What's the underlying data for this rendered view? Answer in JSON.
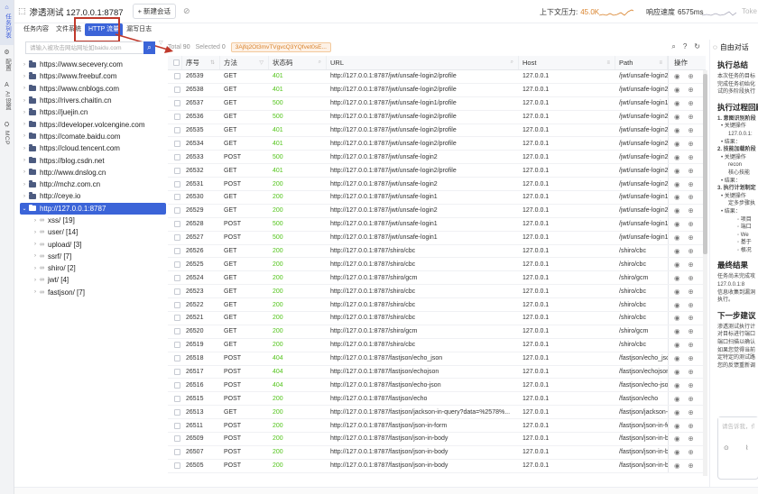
{
  "left_nav": [
    {
      "icon": "⌂",
      "label": "任务列表",
      "active": true
    },
    {
      "icon": "⚙",
      "label": "配置",
      "active": false
    },
    {
      "icon": "A",
      "label": "AI设置",
      "active": false
    },
    {
      "icon": "⛭",
      "label": "MCP",
      "active": false
    }
  ],
  "header": {
    "title": "渗透测试 127.0.0.1:8787",
    "new_button": "+ 新建会话",
    "context_pressure_label": "上下文压力:",
    "context_pressure_value": "45.0K",
    "response_speed_label": "响应速度",
    "response_speed_value": "6575ms",
    "tokens_label": "Toke"
  },
  "tabs": [
    "任务内容",
    "文件系统",
    "HTTP 流量",
    "漏写日志"
  ],
  "active_tab": 2,
  "site_search": {
    "placeholder": "请输入被攻击网站网址如baidu.com"
  },
  "toolbar": {
    "total_label": "Total",
    "total_value": "90",
    "selected_label": "Selected",
    "selected_value": "0",
    "token_tag": "3Ajfq2Ot3mvTVgvcQ3YQfvet0sE..."
  },
  "sites": [
    "https://www.secevery.com",
    "https://www.freebuf.com",
    "https://www.cnblogs.com",
    "https://rivers.chaitin.cn",
    "https://juejin.cn",
    "https://developer.volcengine.com",
    "https://comate.baidu.com",
    "https://cloud.tencent.com",
    "https://blog.csdn.net",
    "http://www.dnslog.cn",
    "http://mchz.com.cn",
    "http://ceye.io"
  ],
  "selected_site": "http://127.0.0.1:8787",
  "site_children": [
    "xss/ [19]",
    "user/ [14]",
    "upload/ [3]",
    "ssrf/ [7]",
    "shiro/ [2]",
    "jwt/ [4]",
    "fastjson/ [7]"
  ],
  "table": {
    "headers": [
      "序号",
      "方法",
      "状态码",
      "URL",
      "Host",
      "Path",
      "操作"
    ],
    "rows": [
      [
        "26539",
        "GET",
        "401",
        "http://127.0.0.1:8787/jwt/unsafe-login2/profile",
        "127.0.0.1",
        "/jwt/unsafe-login2/profile"
      ],
      [
        "26538",
        "GET",
        "401",
        "http://127.0.0.1:8787/jwt/unsafe-login2/profile",
        "127.0.0.1",
        "/jwt/unsafe-login2/profile"
      ],
      [
        "26537",
        "GET",
        "500",
        "http://127.0.0.1:8787/jwt/unsafe-login1/profile",
        "127.0.0.1",
        "/jwt/unsafe-login1/profile"
      ],
      [
        "26536",
        "GET",
        "500",
        "http://127.0.0.1:8787/jwt/unsafe-login2/profile",
        "127.0.0.1",
        "/jwt/unsafe-login2/profile"
      ],
      [
        "26535",
        "GET",
        "401",
        "http://127.0.0.1:8787/jwt/unsafe-login2/profile",
        "127.0.0.1",
        "/jwt/unsafe-login2/profile"
      ],
      [
        "26534",
        "GET",
        "401",
        "http://127.0.0.1:8787/jwt/unsafe-login2/profile",
        "127.0.0.1",
        "/jwt/unsafe-login2/profile"
      ],
      [
        "26533",
        "POST",
        "500",
        "http://127.0.0.1:8787/jwt/unsafe-login2",
        "127.0.0.1",
        "/jwt/unsafe-login2"
      ],
      [
        "26532",
        "GET",
        "401",
        "http://127.0.0.1:8787/jwt/unsafe-login2/profile",
        "127.0.0.1",
        "/jwt/unsafe-login2/profile"
      ],
      [
        "26531",
        "POST",
        "200",
        "http://127.0.0.1:8787/jwt/unsafe-login2",
        "127.0.0.1",
        "/jwt/unsafe-login2"
      ],
      [
        "26530",
        "GET",
        "200",
        "http://127.0.0.1:8787/jwt/unsafe-login1",
        "127.0.0.1",
        "/jwt/unsafe-login1"
      ],
      [
        "26529",
        "GET",
        "200",
        "http://127.0.0.1:8787/jwt/unsafe-login2",
        "127.0.0.1",
        "/jwt/unsafe-login2"
      ],
      [
        "26528",
        "POST",
        "500",
        "http://127.0.0.1:8787/jwt/unsafe-login1",
        "127.0.0.1",
        "/jwt/unsafe-login1"
      ],
      [
        "26527",
        "POST",
        "500",
        "http://127.0.0.1:8787/jwt/unsafe-login1",
        "127.0.0.1",
        "/jwt/unsafe-login1"
      ],
      [
        "26526",
        "GET",
        "200",
        "http://127.0.0.1:8787/shiro/cbc",
        "127.0.0.1",
        "/shiro/cbc"
      ],
      [
        "26525",
        "GET",
        "200",
        "http://127.0.0.1:8787/shiro/cbc",
        "127.0.0.1",
        "/shiro/cbc"
      ],
      [
        "26524",
        "GET",
        "200",
        "http://127.0.0.1:8787/shiro/gcm",
        "127.0.0.1",
        "/shiro/gcm"
      ],
      [
        "26523",
        "GET",
        "200",
        "http://127.0.0.1:8787/shiro/cbc",
        "127.0.0.1",
        "/shiro/cbc"
      ],
      [
        "26522",
        "GET",
        "200",
        "http://127.0.0.1:8787/shiro/cbc",
        "127.0.0.1",
        "/shiro/cbc"
      ],
      [
        "26521",
        "GET",
        "200",
        "http://127.0.0.1:8787/shiro/cbc",
        "127.0.0.1",
        "/shiro/cbc"
      ],
      [
        "26520",
        "GET",
        "200",
        "http://127.0.0.1:8787/shiro/gcm",
        "127.0.0.1",
        "/shiro/gcm"
      ],
      [
        "26519",
        "GET",
        "200",
        "http://127.0.0.1:8787/shiro/cbc",
        "127.0.0.1",
        "/shiro/cbc"
      ],
      [
        "26518",
        "POST",
        "404",
        "http://127.0.0.1:8787/fastjson/echo_json",
        "127.0.0.1",
        "/fastjson/echo_json"
      ],
      [
        "26517",
        "POST",
        "404",
        "http://127.0.0.1:8787/fastjson/echojson",
        "127.0.0.1",
        "/fastjson/echojson"
      ],
      [
        "26516",
        "POST",
        "404",
        "http://127.0.0.1:8787/fastjson/echo-json",
        "127.0.0.1",
        "/fastjson/echo-json"
      ],
      [
        "26515",
        "POST",
        "200",
        "http://127.0.0.1:8787/fastjson/echo",
        "127.0.0.1",
        "/fastjson/echo"
      ],
      [
        "26513",
        "GET",
        "200",
        "http://127.0.0.1:8787/fastjson/jackson-in-query?data=%2578%...",
        "127.0.0.1",
        "/fastjson/jackson-in-query"
      ],
      [
        "26511",
        "POST",
        "200",
        "http://127.0.0.1:8787/fastjson/json-in-form",
        "127.0.0.1",
        "/fastjson/json-in-form"
      ],
      [
        "26509",
        "POST",
        "200",
        "http://127.0.0.1:8787/fastjson/json-in-body",
        "127.0.0.1",
        "/fastjson/json-in-body"
      ],
      [
        "26507",
        "POST",
        "200",
        "http://127.0.0.1:8787/fastjson/json-in-body",
        "127.0.0.1",
        "/fastjson/json-in-body"
      ],
      [
        "26505",
        "POST",
        "200",
        "http://127.0.0.1:8787/fastjson/json-in-body",
        "127.0.0.1",
        "/fastjson/json-in-body"
      ]
    ]
  },
  "right_panel": {
    "header": "自由对话",
    "section1_title": "执行总结",
    "section1_lines": [
      "本次任务的目标",
      "完成任务初始化",
      "试的多阶段执行"
    ],
    "section2_title": "执行过程回顾",
    "section2_lines": [
      "1. 意图识别阶段",
      "• 关键操作",
      "127.0.0.1:",
      "• 结果：",
      "2. 技能加载阶段",
      "• 关键操作",
      "recon",
      "核心技能",
      "• 结果：",
      "3. 执行计划制定",
      "• 关键操作",
      "定多步骤执",
      "• 结果：",
      "◦ 项目",
      "◦ 端口",
      "◦ We",
      "◦ 基于",
      "◦ 根况"
    ],
    "section3_title": "最终结果",
    "section3_lines": [
      "任务尚未完成攻",
      "127.0.0.1:8",
      "信息收集到漏洞",
      "执行。"
    ],
    "section4_title": "下一步建议",
    "section4_lines": [
      "渗透测试执行计",
      "对目标进行端口",
      "端口扫描以确认",
      "如果您觉得当前",
      "定特定的测试路",
      "您的反馈重新调"
    ],
    "chat_placeholder": "请告诉我，你"
  },
  "colors": {
    "accent": "#3b64d8",
    "status_ok": "#52c41a",
    "pressure": "#d9822b",
    "annotation": "#c0392b"
  }
}
